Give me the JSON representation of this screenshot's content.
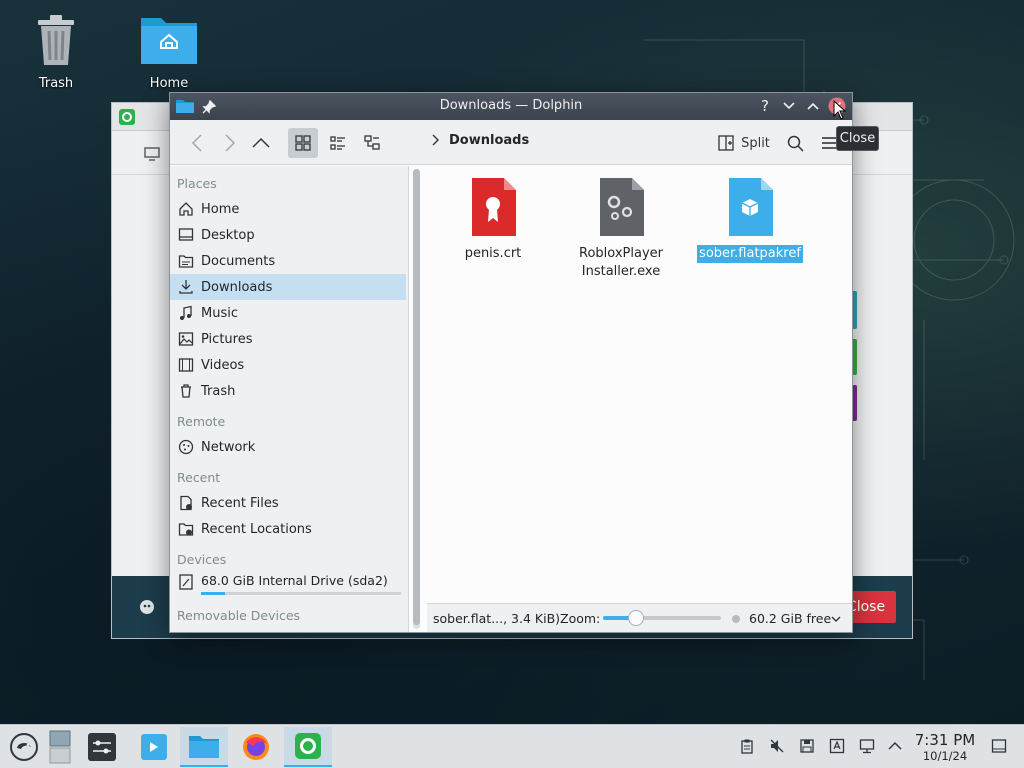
{
  "desktop": {
    "icons": [
      {
        "label": "Trash",
        "icon": "trash-icon"
      },
      {
        "label": "Home",
        "icon": "home-folder-icon"
      }
    ]
  },
  "background_window": {
    "close_label": "Close"
  },
  "window": {
    "title": "Downloads — Dolphin",
    "tooltip": "Close"
  },
  "toolbar": {
    "breadcrumb": "Downloads",
    "split_label": "Split",
    "active_view": "icons"
  },
  "sidebar": {
    "sections": [
      "Places",
      "Remote",
      "Recent",
      "Devices",
      "Removable Devices"
    ],
    "places": [
      {
        "label": "Home",
        "icon": "home-icon"
      },
      {
        "label": "Desktop",
        "icon": "desktop-icon"
      },
      {
        "label": "Documents",
        "icon": "documents-icon"
      },
      {
        "label": "Downloads",
        "icon": "downloads-icon",
        "selected": true
      },
      {
        "label": "Music",
        "icon": "music-icon"
      },
      {
        "label": "Pictures",
        "icon": "pictures-icon"
      },
      {
        "label": "Videos",
        "icon": "videos-icon"
      },
      {
        "label": "Trash",
        "icon": "trash-icon"
      }
    ],
    "remote": [
      {
        "label": "Network",
        "icon": "network-icon"
      }
    ],
    "recent": [
      {
        "label": "Recent Files",
        "icon": "recent-files-icon"
      },
      {
        "label": "Recent Locations",
        "icon": "recent-locations-icon"
      }
    ],
    "devices": [
      {
        "label": "68.0 GiB Internal Drive (sda2)",
        "icon": "drive-icon",
        "usage_fraction": 0.12
      }
    ]
  },
  "files": [
    {
      "name": "penis.crt",
      "icon": "certificate-file-icon",
      "color": "#da2a2a"
    },
    {
      "name_line1": "RobloxPlayer",
      "name_line2": "Installer.exe",
      "icon": "executable-file-icon",
      "color": "#5f6367"
    },
    {
      "name": "sober.flatpakref",
      "icon": "flatpak-file-icon",
      "color": "#3daee9",
      "selected": true
    }
  ],
  "statusbar": {
    "selection_info": "sober.flat..., 3.4 KiB)",
    "zoom_label": "Zoom:",
    "zoom_fraction": 0.28,
    "free_space": "60.2 GiB free"
  },
  "taskbar": {
    "clock_time": "7:31 PM",
    "clock_date": "10/1/24"
  },
  "colors": {
    "accent": "#3daee9",
    "selection_bg": "#c4def2",
    "titlebar": "#3b434d",
    "close_red": "#d9333f"
  }
}
